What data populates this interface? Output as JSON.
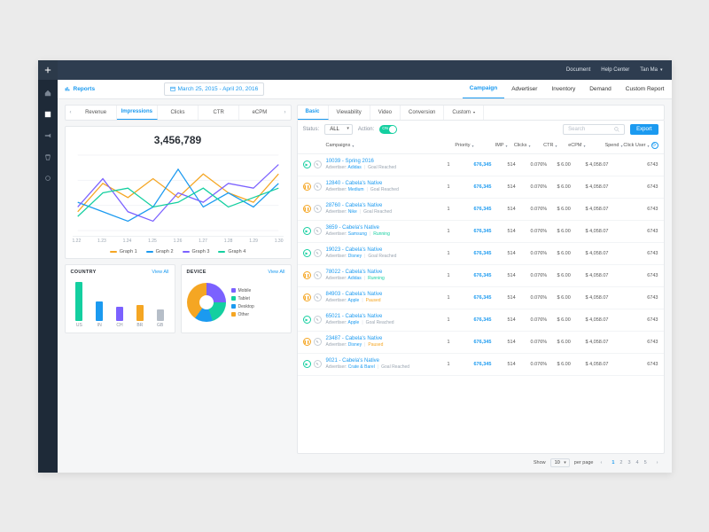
{
  "topnav": {
    "document": "Document",
    "help": "Help Center",
    "user": "Tan Ma"
  },
  "header": {
    "reports_label": "Reports",
    "date_range": "March 25, 2015 - April 20, 2016",
    "tabs": [
      "Campaign",
      "Advertiser",
      "Inventory",
      "Demand",
      "Custom Report"
    ],
    "active": 0
  },
  "metrics": {
    "tabs": [
      "Revenue",
      "Impressions",
      "Clicks",
      "CTR",
      "eCPM"
    ],
    "active": 1,
    "big_number": "3,456,789"
  },
  "chart_data": {
    "type": "line",
    "x": [
      "1.22",
      "1.23",
      "1.24",
      "1.25",
      "1.26",
      "1.27",
      "1.28",
      "1.29",
      "1.30"
    ],
    "yaxis_ticks": [
      "0",
      "5",
      "10",
      "15"
    ],
    "series": [
      {
        "name": "Graph 1",
        "color": "#f5a623",
        "values": [
          4,
          10,
          7,
          11,
          7,
          12,
          8,
          6,
          12
        ]
      },
      {
        "name": "Graph 2",
        "color": "#1b9af0",
        "values": [
          6,
          4,
          2,
          5,
          13,
          5,
          8,
          5,
          10
        ]
      },
      {
        "name": "Graph 3",
        "color": "#7b61ff",
        "values": [
          5,
          11,
          4,
          2,
          8,
          6,
          10,
          9,
          14
        ]
      },
      {
        "name": "Graph 4",
        "color": "#14cfa0",
        "values": [
          3,
          8,
          9,
          5,
          6,
          9,
          5,
          7,
          9
        ]
      }
    ],
    "ylim": [
      0,
      16
    ]
  },
  "country": {
    "title": "COUNTRY",
    "link": "View All",
    "bars": [
      {
        "label": "US",
        "value": 44,
        "color": "#14cfa0"
      },
      {
        "label": "IN",
        "value": 22,
        "color": "#1b9af0"
      },
      {
        "label": "CH",
        "value": 16,
        "color": "#7b61ff"
      },
      {
        "label": "BR",
        "value": 18,
        "color": "#f5a623"
      },
      {
        "label": "GB",
        "value": 13,
        "color": "#b6bec8"
      }
    ]
  },
  "device": {
    "title": "DEVICE",
    "link": "View All",
    "slices": [
      {
        "label": "Mobile",
        "value": 25,
        "color": "#7b61ff"
      },
      {
        "label": "Tablet",
        "value": 20,
        "color": "#14cfa0"
      },
      {
        "label": "Desktop",
        "value": 15,
        "color": "#1b9af0"
      },
      {
        "label": "Other",
        "value": 40,
        "color": "#f5a623"
      }
    ]
  },
  "subtabs": {
    "items": [
      "Basic",
      "Viewability",
      "Video",
      "Conversion",
      "Custom"
    ],
    "active": 0
  },
  "filters": {
    "status_label": "Status:",
    "status_value": "ALL",
    "action_label": "Action:",
    "toggle_text": "ON",
    "search_placeholder": "Search",
    "export": "Export"
  },
  "table": {
    "columns": [
      "Campaigns",
      "Priority",
      "IMP",
      "Clicks",
      "CTR",
      "eCPM",
      "Spend",
      "Click User"
    ],
    "rows": [
      {
        "id": "10039",
        "name": "Spring 2016",
        "adv": "Adidas",
        "status": "Goal Reached",
        "status_cls": "reached",
        "action": "play"
      },
      {
        "id": "12840",
        "name": "Cabela's Native",
        "adv": "Medium",
        "status": "Goal Reached",
        "status_cls": "reached",
        "action": "pause"
      },
      {
        "id": "28760",
        "name": "Cabela's Native",
        "adv": "Nike",
        "status": "Goal Reached",
        "status_cls": "reached",
        "action": "pause"
      },
      {
        "id": "3659",
        "name": "Cabela's Native",
        "adv": "Samsung",
        "status": "Running",
        "status_cls": "running",
        "action": "play"
      },
      {
        "id": "19023",
        "name": "Cabela's Native",
        "adv": "Disney",
        "status": "Goal Reached",
        "status_cls": "reached",
        "action": "play"
      },
      {
        "id": "78022",
        "name": "Cabela's Native",
        "adv": "Adidas",
        "status": "Running",
        "status_cls": "running",
        "action": "pause"
      },
      {
        "id": "84903",
        "name": "Cabela's Native",
        "adv": "Apple",
        "status": "Paused",
        "status_cls": "paused",
        "action": "pause"
      },
      {
        "id": "65021",
        "name": "Cabela's Native",
        "adv": "Apple",
        "status": "Goal Reached",
        "status_cls": "reached",
        "action": "play"
      },
      {
        "id": "23487",
        "name": "Cabela's Native",
        "adv": "Disney",
        "status": "Paused",
        "status_cls": "paused",
        "action": "pause"
      },
      {
        "id": "9021",
        "name": "Cabela's Native",
        "adv": "Crate & Barel",
        "status": "Goal Reached",
        "status_cls": "reached",
        "action": "play"
      }
    ],
    "shared": {
      "priority": "1",
      "imp": "676,345",
      "clicks": "514",
      "ctr": "0.076%",
      "ecpm": "$ 6.00",
      "spend": "$ 4,058.07",
      "click_user": "6743"
    }
  },
  "pager": {
    "show": "Show",
    "per_page": "per page",
    "size": "10",
    "pages": [
      "1",
      "2",
      "3",
      "4",
      "5"
    ],
    "active": 0
  }
}
